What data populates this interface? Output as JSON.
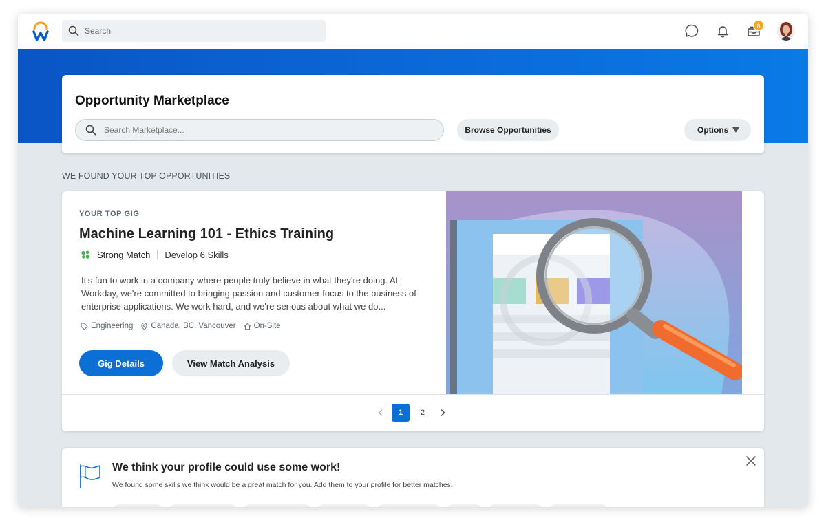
{
  "topbar": {
    "search_placeholder": "Search",
    "inbox_badge_count": "8"
  },
  "marketplace": {
    "title": "Opportunity Marketplace",
    "search_placeholder": "Search Marketplace...",
    "browse_label": "Browse Opportunities",
    "options_label": "Options"
  },
  "section": {
    "heading": "WE FOUND YOUR TOP OPPORTUNITIES"
  },
  "gig": {
    "eyebrow": "YOUR TOP GIG",
    "title": "Machine Learning 101 - Ethics Training",
    "match_label": "Strong Match",
    "skills_label": "Develop 6 Skills",
    "description": "It's fun to work in a company where people truly believe in what they're doing. At Workday, we're committed to bringing passion and customer focus to the business of enterprise applications. We work hard, and we're serious about what we do...",
    "tags": {
      "category": "Engineering",
      "location": "Canada, BC, Vancouver",
      "site": "On-Site"
    },
    "details_label": "Gig Details",
    "analysis_label": "View Match Analysis"
  },
  "pager": {
    "pages": [
      "1",
      "2"
    ],
    "current": "1"
  },
  "profile_prompt": {
    "title": "We think your profile could use some work!",
    "subtitle": "We found some skills we think would be a great match for you. Add them to your profile for better matches."
  },
  "colors": {
    "brand_blue": "#0b6fd6",
    "badge_orange": "#f5a623",
    "match_green": "#3db54a"
  }
}
